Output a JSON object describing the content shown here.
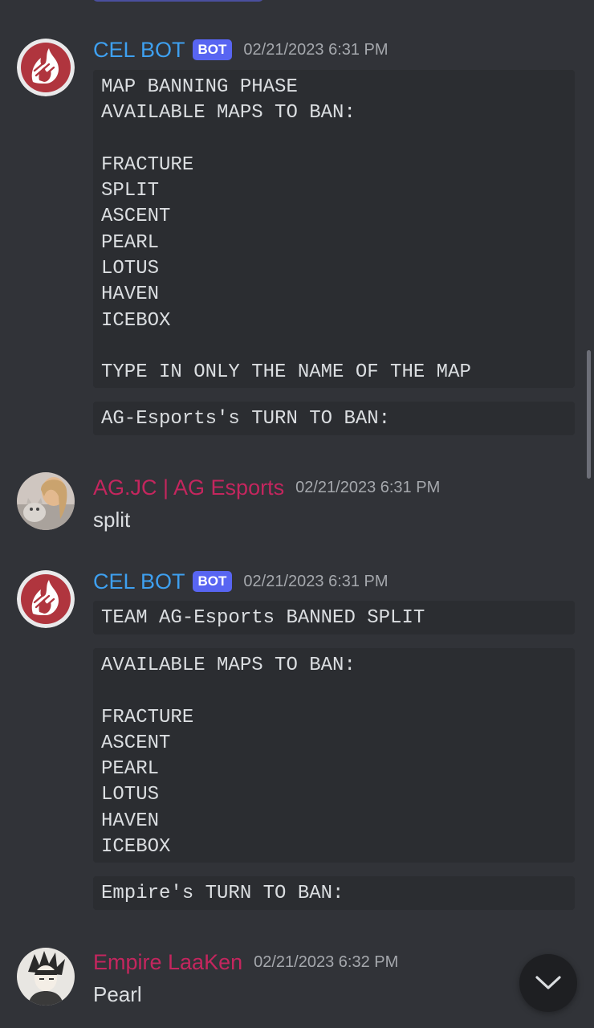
{
  "messages": [
    {
      "username": "CEL BOT",
      "bot_tag": "BOT",
      "timestamp": "02/21/2023 6:31 PM",
      "avatar_icon": "cel-flame-logo-icon",
      "blocks": [
        "MAP BANNING PHASE\nAVAILABLE MAPS TO BAN:\n\nFRACTURE\nSPLIT\nASCENT\nPEARL\nLOTUS\nHAVEN\nICEBOX\n\nTYPE IN ONLY THE NAME OF THE MAP",
        "AG-Esports's TURN TO BAN:"
      ]
    },
    {
      "username": "AG.JC | AG Esports",
      "timestamp": "02/21/2023 6:31 PM",
      "avatar_icon": "user-photo-avatar",
      "text": "split"
    },
    {
      "username": "CEL BOT",
      "bot_tag": "BOT",
      "timestamp": "02/21/2023 6:31 PM",
      "avatar_icon": "cel-flame-logo-icon",
      "blocks": [
        "TEAM AG-Esports BANNED SPLIT",
        "AVAILABLE MAPS TO BAN:\n\nFRACTURE\nASCENT\nPEARL\nLOTUS\nHAVEN\nICEBOX",
        "Empire's TURN TO BAN:"
      ]
    },
    {
      "username": "Empire LaaKen",
      "timestamp": "02/21/2023 6:32 PM",
      "avatar_icon": "anime-character-avatar",
      "text": "Pearl"
    }
  ],
  "scroll_button": {
    "icon": "chevron-down-icon"
  },
  "colors": {
    "background": "#313338",
    "codeblock": "#2b2d31",
    "bot_name": "#3ea0f0",
    "member_name": "#c4265e",
    "bot_tag": "#5865f2",
    "timestamp": "#a5a8ad"
  }
}
